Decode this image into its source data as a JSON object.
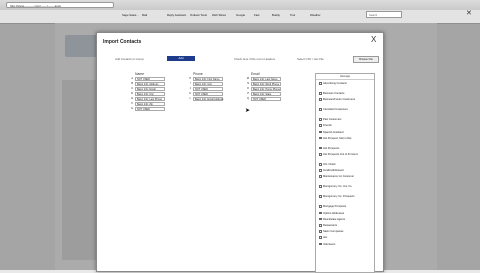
{
  "browser": {
    "url": "http://www.———.com/——/——.aspx",
    "toolbar_items": [
      "Sage Sales…",
      "Mail",
      "Reply Assistant",
      "Outlook Tools",
      "Web Slices",
      "Google",
      "Fast",
      "Buddy",
      "Tool",
      "Weather"
    ],
    "search_placeholder": "Search"
  },
  "dialog": {
    "title": "Import Contacts",
    "close_label": "X",
    "row_label": "Add Contacts to Group:",
    "row_button": "Add",
    "mid_text": "Check here if this row is Headers",
    "right_text": "Select CSV / xlsx File",
    "right_button": "Browse File",
    "columns": [
      {
        "header": "Name",
        "rows": [
          {
            "num": "A",
            "value": "NOT USED"
          },
          {
            "num": "B",
            "value": "Basic Info: Address"
          },
          {
            "num": "C",
            "value": "Basic Info: Email"
          },
          {
            "num": "D",
            "value": "Basic Info: City"
          },
          {
            "num": "E",
            "value": "Basic Info: Last Phone"
          },
          {
            "num": "F",
            "value": "Basic Info: Zip"
          },
          {
            "num": "G",
            "value": "NOT USED"
          }
        ]
      },
      {
        "header": "Phone",
        "rows": [
          {
            "num": "H",
            "value": "Basic Info: First Name"
          },
          {
            "num": "I",
            "value": "Basic Info: Cell"
          },
          {
            "num": "J",
            "value": "NOT USED"
          },
          {
            "num": "K",
            "value": "NOT USED"
          },
          {
            "num": "L",
            "value": "Basic Info: Email Address"
          }
        ]
      },
      {
        "header": "Email",
        "rows": [
          {
            "num": "M",
            "value": "Basic Info: Last Name"
          },
          {
            "num": "N",
            "value": "Basic Info: Work Phone"
          },
          {
            "num": "O",
            "value": "Basic Info: Home Phone"
          },
          {
            "num": "P",
            "value": "Basic Info: State"
          },
          {
            "num": "Q",
            "value": "NOT USED"
          }
        ]
      }
    ],
    "groups_header": "Groups",
    "groups": [
      "Advertising Contacts",
      "Business Contacts",
      "Business/Future Customers",
      "Cancelled Customers",
      "Past Customers",
      "Friends",
      "Spanish Husband",
      "Hot Prospect, Met in-Net",
      "Hot Prospects",
      "Hot Prospects Out of IN Users",
      "Info / Rank",
      "Invalid Addressed",
      "Maintenance Inc Customer",
      "Montgomery Inc. Our Co.",
      "Montgomery Inc. Prospects",
      "Mortgage Prospects",
      "OptOut Addresses",
      "Real Estate Agents",
      "Restaurants",
      "Salon Companies",
      "test",
      "Volunteers"
    ]
  }
}
